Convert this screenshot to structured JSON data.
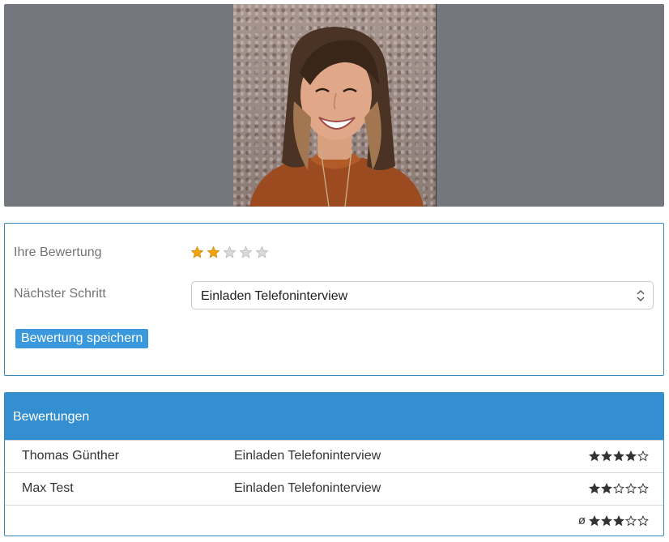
{
  "banner": {
    "photo_alt": "Bewerberfoto"
  },
  "rating_form": {
    "your_rating_label": "Ihre Bewertung",
    "your_rating_value": 2,
    "your_rating_max": 5,
    "next_step_label": "Nächster Schritt",
    "next_step_selected": "Einladen Telefoninterview",
    "save_button_label": "Bewertung speichern"
  },
  "ratings": {
    "title": "Bewertungen",
    "rows": [
      {
        "name": "Thomas Günther",
        "step": "Einladen Telefoninterview",
        "stars": 4
      },
      {
        "name": "Max Test",
        "step": "Einladen Telefoninterview",
        "stars": 2
      }
    ],
    "average": {
      "symbol": "ø",
      "stars": 3
    },
    "max_stars": 5
  },
  "colors": {
    "star_active": "#f0a30a",
    "star_inactive": "#d9d9d9",
    "accent": "#338fd0",
    "card_border": "#3a8bbd"
  }
}
